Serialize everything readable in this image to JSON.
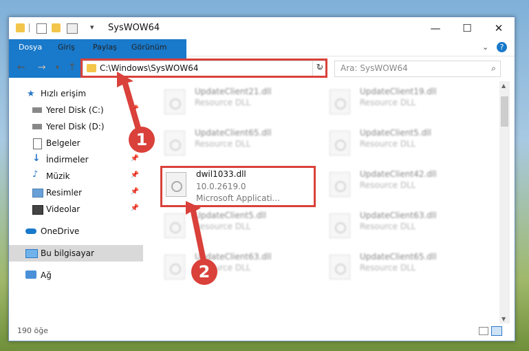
{
  "window": {
    "title": "SysWOW64"
  },
  "ribbon": {
    "tabs": [
      "Dosya",
      "Giriş",
      "Paylaş",
      "Görünüm"
    ]
  },
  "address": {
    "path": "C:\\Windows\\SysWOW64"
  },
  "search": {
    "placeholder": "Ara: SysWOW64"
  },
  "sidebar": {
    "items": [
      {
        "label": "Hızlı erişim",
        "icon": "star-icon"
      },
      {
        "label": "Yerel Disk (C:)",
        "icon": "drive-icon"
      },
      {
        "label": "Yerel Disk (D:)",
        "icon": "drive-icon"
      },
      {
        "label": "Belgeler",
        "icon": "document-icon"
      },
      {
        "label": "İndirmeler",
        "icon": "download-icon"
      },
      {
        "label": "Müzik",
        "icon": "music-icon"
      },
      {
        "label": "Resimler",
        "icon": "pictures-icon"
      },
      {
        "label": "Videolar",
        "icon": "video-icon"
      },
      {
        "label": "OneDrive",
        "icon": "cloud-icon"
      },
      {
        "label": "Bu bilgisayar",
        "icon": "computer-icon"
      },
      {
        "label": "Ağ",
        "icon": "network-icon"
      }
    ]
  },
  "files": [
    {
      "name": "UpdateClient21.dll",
      "type": "Resource DLL"
    },
    {
      "name": "UpdateClient19.dll",
      "type": "Resource DLL"
    },
    {
      "name": "UpdateClient65.dll",
      "type": "Resource DLL"
    },
    {
      "name": "UpdateClient5.dll",
      "type": "Resource DLL"
    },
    {
      "name": "dwil1033.dll",
      "version": "10.0.2619.0",
      "type": "Microsoft Applicati..."
    },
    {
      "name": "UpdateClient42.dll",
      "type": "Resource DLL"
    },
    {
      "name": "UpdateClient5.dll",
      "type": "Resource DLL"
    },
    {
      "name": "UpdateClient63.dll",
      "type": "Resource DLL"
    },
    {
      "name": "UpdateClient63.dll",
      "type": "Resource DLL"
    },
    {
      "name": "UpdateClient65.dll",
      "type": "Resource DLL"
    }
  ],
  "status": {
    "count": "190 öğe"
  },
  "annotations": {
    "badge1": "1",
    "badge2": "2"
  },
  "colors": {
    "accent": "#1979ca",
    "highlight": "#d9413a"
  }
}
